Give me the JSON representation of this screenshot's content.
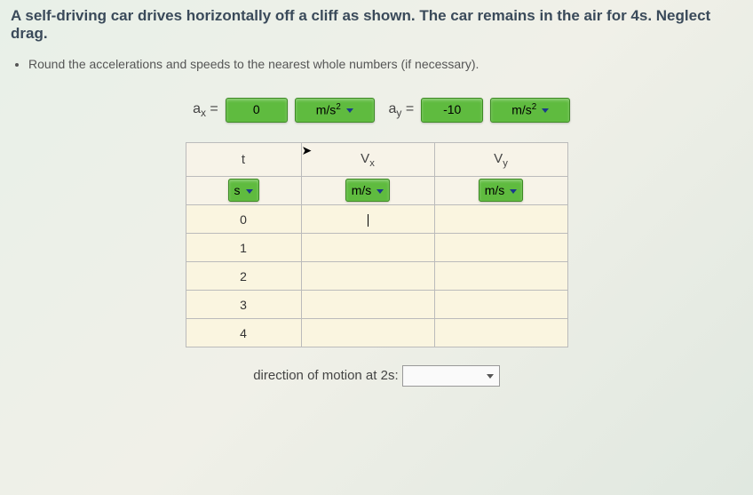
{
  "problem": {
    "title": "A self-driving car drives horizontally off a cliff as shown. The car remains in the air for 4s. Neglect drag.",
    "instruction": "Round the accelerations and speeds to the nearest whole numbers (if necessary)."
  },
  "accelerations": {
    "ax_label": "aₓ =",
    "ax_value": "0",
    "ax_unit": "m/s²",
    "ay_label": "aᵧ =",
    "ay_value": "-10",
    "ay_unit": "m/s²"
  },
  "table": {
    "headers": {
      "t": "t",
      "vx": "Vₓ",
      "vy": "Vᵧ"
    },
    "unit_row": {
      "t_unit": "s",
      "vx_unit": "m/s",
      "vy_unit": "m/s"
    },
    "rows": [
      {
        "t": "0",
        "vx": "",
        "vy": ""
      },
      {
        "t": "1",
        "vx": "",
        "vy": ""
      },
      {
        "t": "2",
        "vx": "",
        "vy": ""
      },
      {
        "t": "3",
        "vx": "",
        "vy": ""
      },
      {
        "t": "4",
        "vx": "",
        "vy": ""
      }
    ]
  },
  "direction": {
    "label": "direction of motion at 2s:",
    "value": ""
  }
}
